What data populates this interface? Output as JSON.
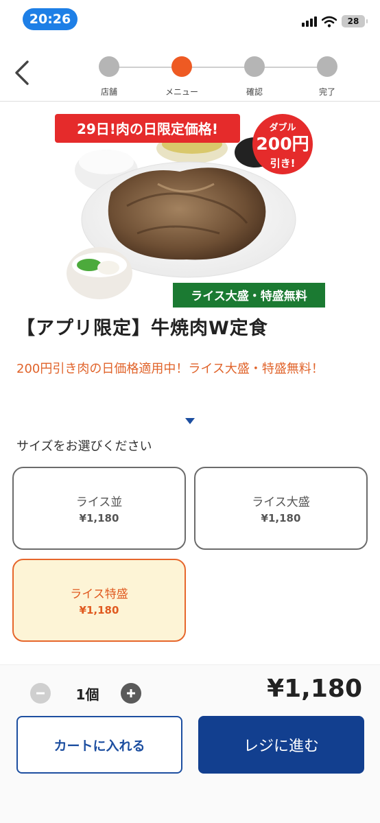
{
  "status_bar": {
    "time": "20:26",
    "battery": "28"
  },
  "steps": [
    {
      "label": "店舗"
    },
    {
      "label": "メニュー"
    },
    {
      "label": "確認"
    },
    {
      "label": "完了"
    }
  ],
  "hero": {
    "banner": "29日!肉の日限定価格!",
    "badge_top": "ダブル",
    "badge_amount": "200円",
    "badge_bottom": "引き!",
    "ribbon": "ライス大盛・特盛無料"
  },
  "product": {
    "title": "【アプリ限定】牛焼肉W定食",
    "promo": "200円引き肉の日価格適用中！ライス大盛・特盛無料！"
  },
  "size_section": {
    "label": "サイズをお選びください",
    "options": [
      {
        "name": "ライス並",
        "price": "¥1,180"
      },
      {
        "name": "ライス大盛",
        "price": "¥1,180"
      },
      {
        "name": "ライス特盛",
        "price": "¥1,180"
      }
    ]
  },
  "cart": {
    "quantity": "1個",
    "total": "¥1,180",
    "add_to_cart": "カートに入れる",
    "checkout": "レジに進む"
  },
  "colors": {
    "accent": "#ee5a23",
    "primary": "#123f8f",
    "selected_bg": "#fdf4d6"
  }
}
